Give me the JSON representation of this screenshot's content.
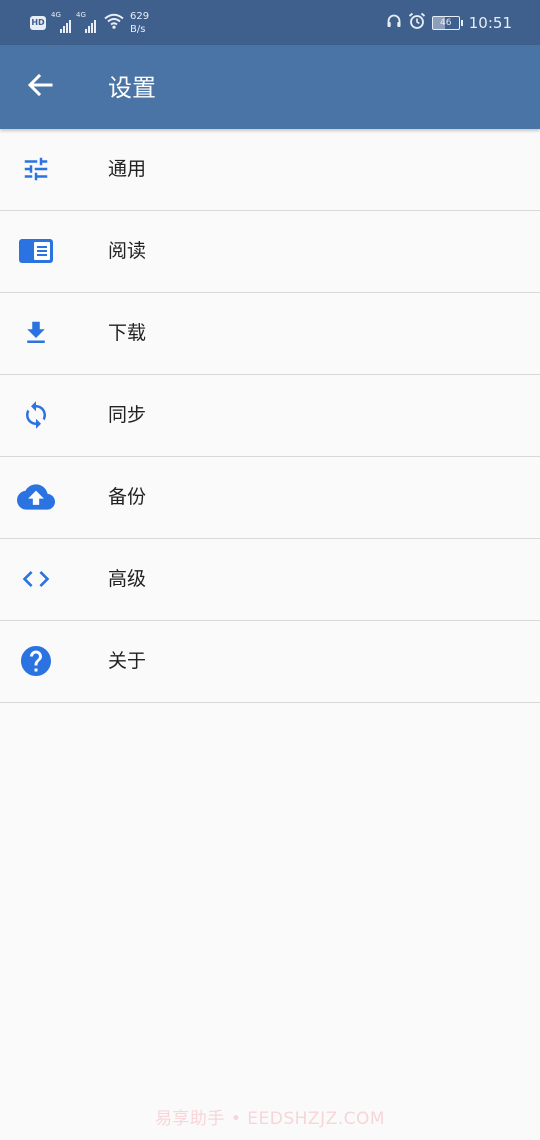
{
  "status_bar": {
    "hd": "HD",
    "net1": "4G",
    "net2": "4G",
    "speed_value": "629",
    "speed_unit": "B/s",
    "battery": "46",
    "battery_level": 0.46,
    "time": "10:51",
    "icons": [
      "hd-icon",
      "signal-icon",
      "wifi-icon",
      "headphone-icon",
      "alarm-icon",
      "battery-icon"
    ]
  },
  "app_bar": {
    "title": "设置",
    "back_icon": "arrow-left-icon"
  },
  "menu": {
    "items": [
      {
        "label": "通用",
        "icon": "tune-icon"
      },
      {
        "label": "阅读",
        "icon": "book-open-icon"
      },
      {
        "label": "下载",
        "icon": "download-icon"
      },
      {
        "label": "同步",
        "icon": "sync-icon"
      },
      {
        "label": "备份",
        "icon": "cloud-upload-icon"
      },
      {
        "label": "高级",
        "icon": "code-icon"
      },
      {
        "label": "关于",
        "icon": "help-circle-icon"
      }
    ]
  },
  "watermark": "易享助手 • EEDSHZJZ.COM",
  "colors": {
    "status_bar": "#3f5f8c",
    "app_bar": "#4b74a6",
    "accent": "#2b73e0",
    "background": "#fafafa",
    "divider": "#d9d9d9"
  }
}
